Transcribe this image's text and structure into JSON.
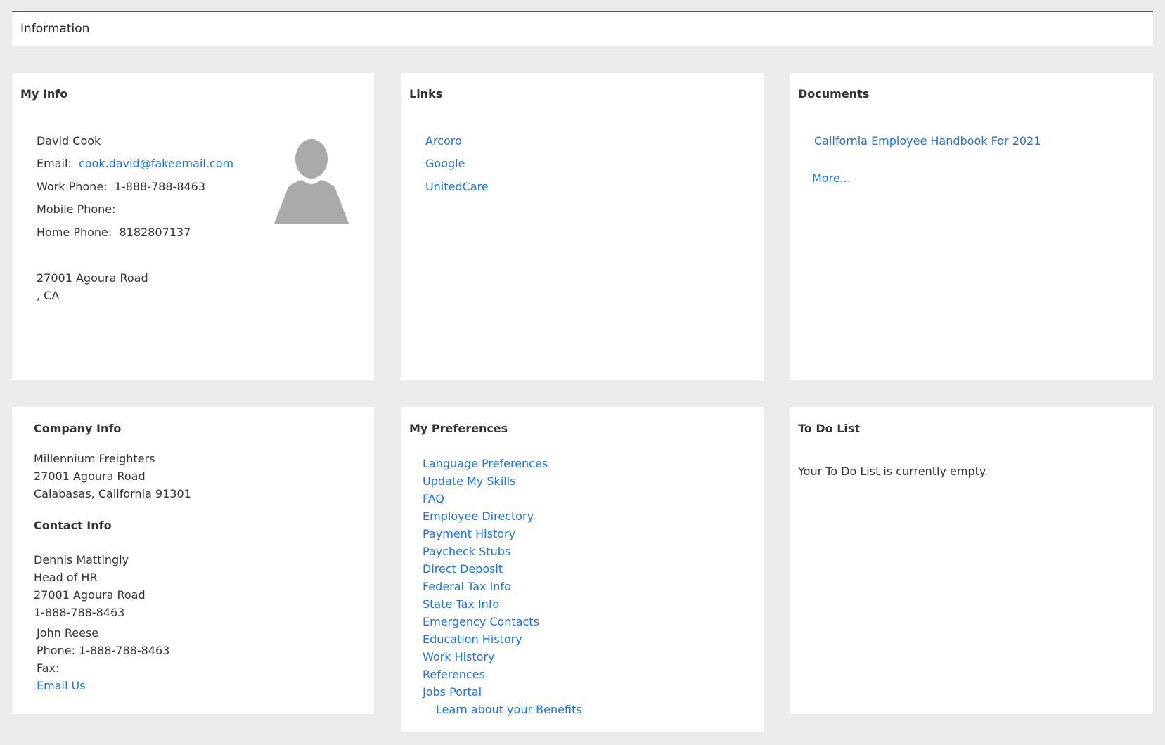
{
  "header": {
    "title": "Information"
  },
  "my_info": {
    "title": "My Info",
    "name": "David Cook",
    "email_label": "Email:",
    "email": "cook.david@fakeemail.com",
    "work_phone_label": "Work Phone:",
    "work_phone": "1-888-788-8463",
    "mobile_phone_label": "Mobile Phone:",
    "home_phone_label": "Home Phone:",
    "home_phone": "8182807137",
    "address_line1": "27001 Agoura Road",
    "address_line2": ", CA",
    "avatar_icon": "user-avatar-icon"
  },
  "links": {
    "title": "Links",
    "items": [
      "Arcoro",
      "Google",
      "UnitedCare"
    ]
  },
  "documents": {
    "title": "Documents",
    "items": [
      "California Employee Handbook For 2021"
    ],
    "more_label": "More..."
  },
  "company_info": {
    "title": "Company Info",
    "company_name": "Millennium Freighters",
    "address_line1": "27001 Agoura Road",
    "address_line2": "Calabasas, California 91301",
    "contact_title": "Contact Info",
    "contact_name": "Dennis Mattingly",
    "contact_role": "Head of HR",
    "contact_address": "27001 Agoura Road",
    "contact_phone": "1-888-788-8463",
    "second_name": "John Reese",
    "second_phone": "Phone: 1-888-788-8463",
    "second_fax": "Fax:",
    "email_us_label": "Email Us"
  },
  "preferences": {
    "title": "My Preferences",
    "items": [
      "Language Preferences",
      "Update My Skills",
      "FAQ",
      "Employee Directory",
      "Payment History",
      "Paycheck Stubs",
      "Direct Deposit",
      "Federal Tax Info",
      "State Tax Info",
      "Emergency Contacts",
      "Education History",
      "Work History",
      "References",
      "Jobs Portal"
    ],
    "benefits_label": "Learn about your Benefits"
  },
  "todo": {
    "title": "To Do List",
    "empty_message": "Your To Do List is currently empty."
  },
  "colors": {
    "background": "#ebebeb",
    "panel": "#ffffff",
    "link": "#1a73e8",
    "text": "#333333",
    "avatar": "#aaaaaa"
  }
}
